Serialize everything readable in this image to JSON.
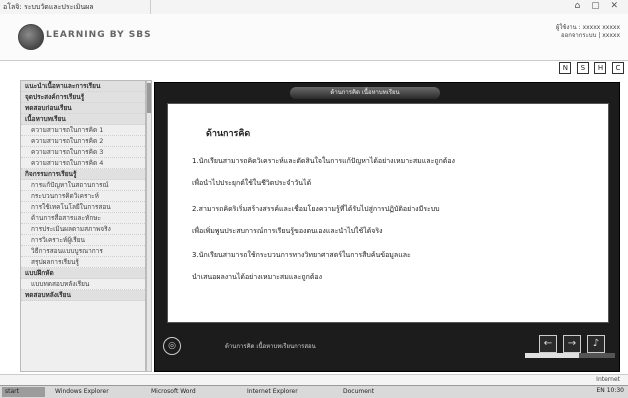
{
  "window": {
    "title": "อโลจิ: ระบบวัดและประเมินผล",
    "controls": "⌂ ▢ ✕"
  },
  "header": {
    "brand": "LEARNING BY SBS",
    "user_line1": "ผู้ใช้งาน : xxxxx xxxxx",
    "user_line2": "ออกจากระบบ | xxxxx"
  },
  "toolbar": [
    "N",
    "S",
    "H",
    "C"
  ],
  "sidebar": {
    "items": [
      {
        "label": "แนะนำเนื้อหาและการเรียน",
        "kind": "section"
      },
      {
        "label": "จุดประสงค์การเรียนรู้",
        "kind": "section"
      },
      {
        "label": "ทดสอบก่อนเรียน",
        "kind": "section"
      },
      {
        "label": "เนื้อหาบทเรียน",
        "kind": "section"
      },
      {
        "label": "ความสามารถในการคิด 1",
        "kind": "sub"
      },
      {
        "label": "ความสามารถในการคิด 2",
        "kind": "sub"
      },
      {
        "label": "ความสามารถในการคิด 3",
        "kind": "sub"
      },
      {
        "label": "ความสามารถในการคิด 4",
        "kind": "sub"
      },
      {
        "label": "กิจกรรมการเรียนรู้",
        "kind": "section"
      },
      {
        "label": "การแก้ปัญหาในสถานการณ์",
        "kind": "sub"
      },
      {
        "label": "กระบวนการคิดวิเคราะห์",
        "kind": "sub"
      },
      {
        "label": "การใช้เทคโนโลยีในการสอน",
        "kind": "sub"
      },
      {
        "label": "ด้านการสื่อสารและทักษะ",
        "kind": "sub"
      },
      {
        "label": "การประเมินผลตามสภาพจริง",
        "kind": "sub"
      },
      {
        "label": "การวิเคราะห์ผู้เรียน",
        "kind": "sub"
      },
      {
        "label": "วิธีการสอนแบบบูรณาการ",
        "kind": "sub"
      },
      {
        "label": "สรุปผลการเรียนรู้",
        "kind": "sub"
      },
      {
        "label": "แบบฝึกหัด",
        "kind": "section"
      },
      {
        "label": "แบบทดสอบหลังเรียน",
        "kind": "sub"
      },
      {
        "label": "ทดสอบหลังเรียน",
        "kind": "section"
      }
    ]
  },
  "viewer": {
    "header": "ด้านการคิด เนื้อหาบทเรียน",
    "heading": "ด้านการคิด",
    "lines": [
      "1.นักเรียนสามารถคิดวิเคราะห์และตัดสินใจในการแก้ปัญหาได้อย่างเหมาะสมและถูกต้อง",
      "เพื่อนำไปประยุกต์ใช้ในชีวิตประจำวันได้",
      "2.สามารถคิดริเริ่มสร้างสรรค์และเชื่อมโยงความรู้ที่ได้รับไปสู่การปฏิบัติอย่างมีระบบ",
      "เพื่อเพิ่มพูนประสบการณ์การเรียนรู้ของตนเองและนำไปใช้ได้จริง",
      "3.นักเรียนสามารถใช้กระบวนการทางวิทยาศาสตร์ในการสืบค้นข้อมูลและ",
      "นำเสนอผลงานได้อย่างเหมาะสมและถูกต้อง"
    ],
    "caption": "ด้านการคิด เนื้อหาบทเรียนการสอน",
    "nav": {
      "prev": "←",
      "next": "→",
      "audio": "♪"
    },
    "circle_symbol": "◎",
    "progress": 0.6
  },
  "statusbar": {
    "zone": "Internet"
  },
  "taskbar": {
    "start": "start",
    "buttons": [
      "Windows Explorer",
      "Microsoft Word",
      "Internet Explorer",
      "Document"
    ],
    "tray": "EN 10:30"
  }
}
